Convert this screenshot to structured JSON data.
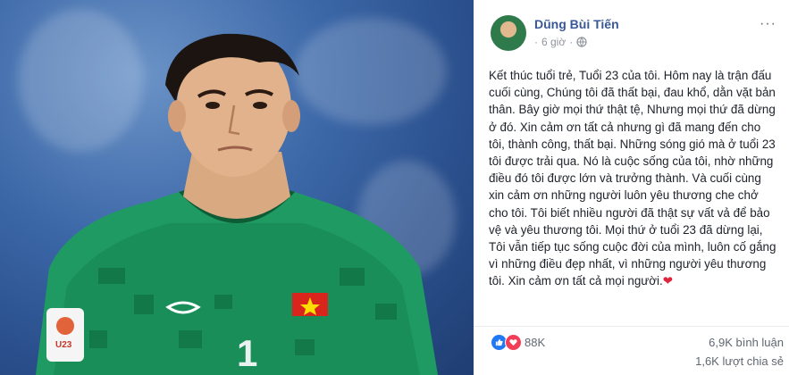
{
  "post": {
    "author": "Dũng Bùi Tiến",
    "time": "6 giờ",
    "more_label": "···",
    "text": "Kết thúc tuổi trẻ, Tuổi 23 của tôi. Hôm nay là trận đấu cuối cùng, Chúng tôi đã thất bại, đau khổ, dằn vặt bản thân. Bây giờ mọi thứ thật tệ, Nhưng mọi thứ đã dừng ở đó. Xin cảm ơn tất cả nhưng gì đã mang đến cho tôi, thành công, thất bại. Những sóng gió mà ở tuổi 23 tôi được trải qua. Nó là cuộc sống của tôi, nhờ những điều đó tôi được lớn và trưởng thành. Và cuối cùng xin cảm ơn những người luôn yêu thương che chở cho tôi. Tôi biết nhiều người đã thật sự vất vả để bảo vệ và yêu thương tôi. Mọi thứ ở tuổi 23 đã dừng lại, Tôi vẫn tiếp tục sống cuộc đời của mình, luôn cố gắng vì những điều đẹp nhất, vì những người yêu thương tôi. Xin cảm ơn tất cả mọi người.",
    "heart_emoji": "❤"
  },
  "stats": {
    "reactions": "88K",
    "comments": "6,9K bình luận",
    "shares": "1,6K lượt chia sẻ"
  },
  "photo": {
    "jersey_number": "1",
    "badge_text": "U23"
  },
  "icons": {
    "privacy": "globe-icon",
    "like": "like-icon",
    "love": "love-icon"
  },
  "colors": {
    "author": "#385898",
    "like": "#2078f4",
    "love": "#f33e58",
    "jersey": "#1e9a62"
  }
}
